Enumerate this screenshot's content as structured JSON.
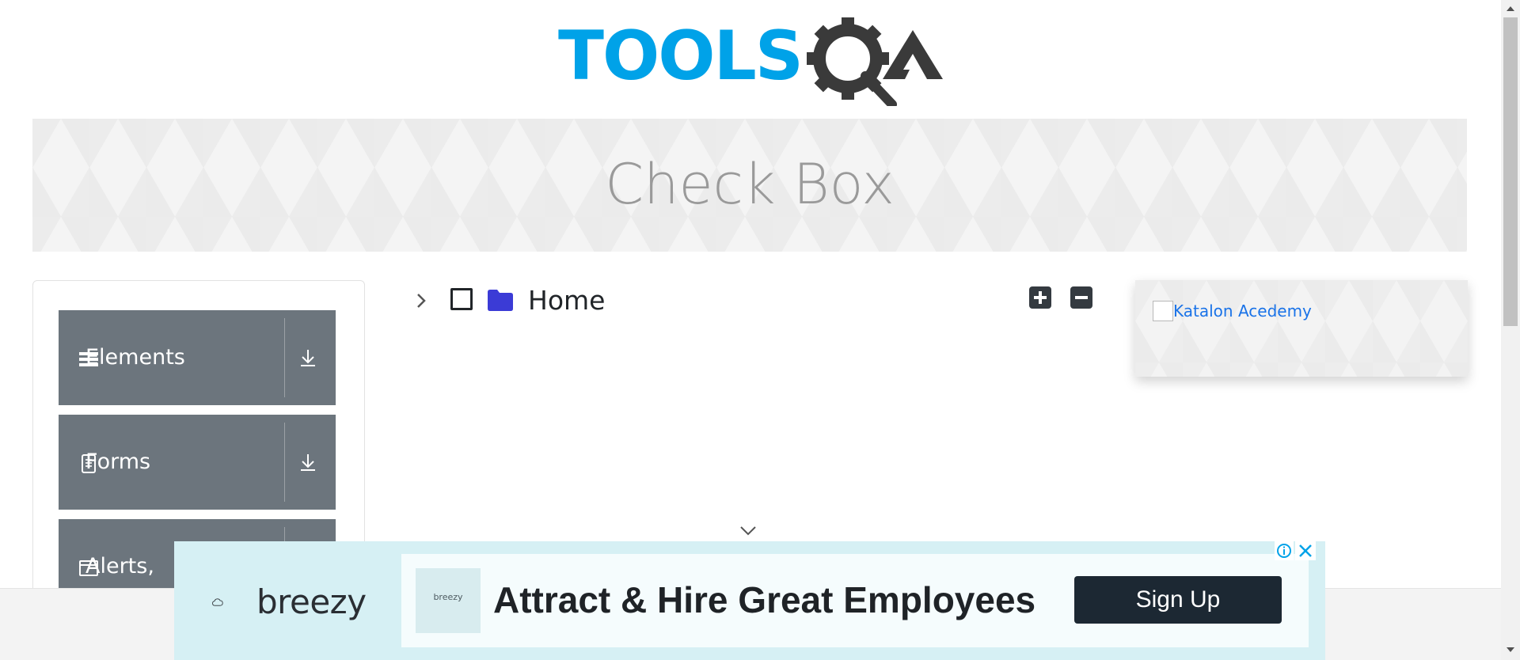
{
  "header": {
    "logo_text": "TOOLSQA",
    "logo_primary": "TOOLS",
    "logo_secondary": "QA",
    "brand_blue": "#00a2e8",
    "brand_dark": "#3a3a3a"
  },
  "banner": {
    "title": "Check Box"
  },
  "sidebar": {
    "groups": [
      {
        "label": "Elements",
        "icon": "hamburger-icon"
      },
      {
        "label": "Forms",
        "icon": "document-icon"
      },
      {
        "label": "Alerts,",
        "icon": "window-icon"
      }
    ],
    "group_color": "#6c757d"
  },
  "tree": {
    "root_label": "Home",
    "expanded": false,
    "checked": false,
    "folder_color": "#3b3bd6",
    "expand_all_icon": "plus-icon",
    "collapse_all_icon": "minus-icon"
  },
  "side_ad": {
    "link_text": "Katalon Acedemy",
    "link_color": "#1a73e8"
  },
  "bottom_ad": {
    "brand": "breezy",
    "thumbnail_brand": "breezy",
    "headline": "Attract & Hire Great Employees",
    "cta": "Sign Up",
    "background": "#d6f0f4",
    "cta_color": "#1c2833"
  }
}
